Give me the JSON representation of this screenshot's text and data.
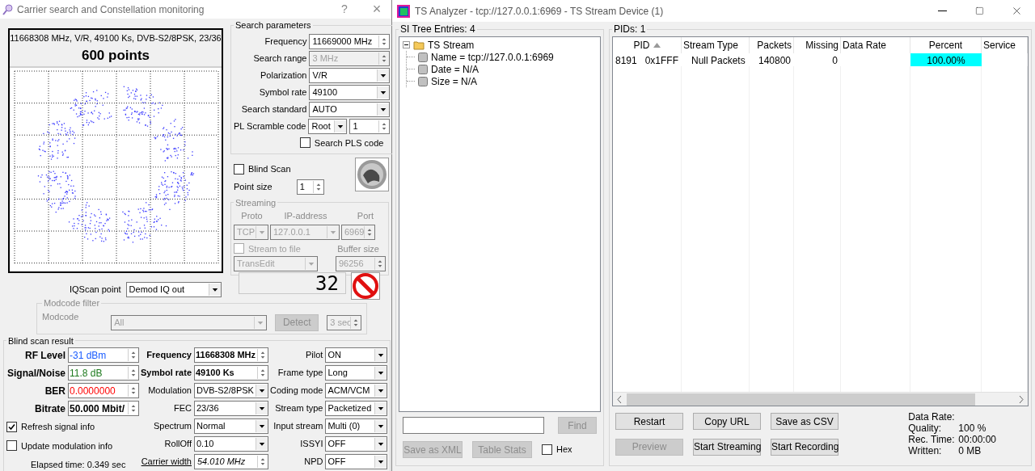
{
  "left_window": {
    "title": "Carrier search and Constellation monitoring",
    "help": "?",
    "close": "×"
  },
  "plot": {
    "info": "11668308 MHz, V/R, 49100 Ks, DVB-S2/8PSK, 23/36",
    "points": "600 points"
  },
  "search_parameters": {
    "title": "Search parameters",
    "fields": [
      {
        "label": "Frequency",
        "value": "11669000 MHz",
        "kind": "spin",
        "disabled": false
      },
      {
        "label": "Search range",
        "value": "3 MHz",
        "kind": "spin",
        "disabled": true
      },
      {
        "label": "Polarization",
        "value": "V/R",
        "kind": "select",
        "disabled": false
      },
      {
        "label": "Symbol rate",
        "value": "49100",
        "kind": "select",
        "disabled": false
      },
      {
        "label": "Search standard",
        "value": "AUTO",
        "kind": "select",
        "disabled": false
      }
    ],
    "scramble": {
      "label": "PL Scramble code",
      "mode": "Root",
      "code": "1"
    },
    "search_pls": {
      "label": "Search PLS code",
      "checked": false
    }
  },
  "blind_scan": {
    "label": "Blind Scan",
    "checked": false
  },
  "point_size": {
    "label": "Point size",
    "value": "1"
  },
  "streaming": {
    "title": "Streaming",
    "disabled": true,
    "proto_label": "Proto",
    "ip_label": "IP-address",
    "port_label": "Port",
    "proto": "TCP",
    "ip": "127.0.0.1",
    "port": "6969",
    "to_file": {
      "label": "Stream to file",
      "checked": false
    },
    "buffer_label": "Buffer size",
    "target": "TransEdit",
    "buffer": "96256"
  },
  "counter": "32",
  "iq_scan": {
    "label": "IQScan point",
    "value": "Demod IQ out"
  },
  "modcode_filter": {
    "title": "Modcode filter",
    "disabled": true,
    "label": "Modcode",
    "value": "All",
    "detect": "Detect",
    "time": "3 sec"
  },
  "blind_scan_result": {
    "title": "Blind scan result",
    "signal": [
      {
        "label": "RF Level",
        "value": "-31 dBm",
        "color": "#1a5cff",
        "bold": false
      },
      {
        "label": "Signal/Noise",
        "value": "11.8 dB",
        "color": "#1e7a1e",
        "bold": false
      },
      {
        "label": "BER",
        "value": "0.0000000",
        "color": "#ff0000",
        "bold": false
      },
      {
        "label": "Bitrate",
        "value": "50.000 Mbit/",
        "color": "#000000",
        "bold": true
      }
    ],
    "params": [
      {
        "label": "Frequency",
        "value": "11668308 MHz",
        "kind": "spin"
      },
      {
        "label": "Symbol rate",
        "value": "49100 Ks",
        "kind": "spin"
      },
      {
        "label": "Modulation",
        "value": "DVB-S2/8PSK",
        "kind": "select"
      },
      {
        "label": "FEC",
        "value": "23/36",
        "kind": "select"
      },
      {
        "label": "Spectrum",
        "value": "Normal",
        "kind": "select"
      },
      {
        "label": "RollOff",
        "value": "0.10",
        "kind": "select"
      },
      {
        "label": "Carrier width",
        "value": "54.010 MHz",
        "kind": "link"
      }
    ],
    "stream": [
      {
        "label": "Pilot",
        "value": "ON"
      },
      {
        "label": "Frame type",
        "value": "Long"
      },
      {
        "label": "Coding mode",
        "value": "ACM/VCM"
      },
      {
        "label": "Stream type",
        "value": "Packetized"
      },
      {
        "label": "Input stream",
        "value": "Multi (0)"
      },
      {
        "label": "ISSYI",
        "value": "OFF"
      },
      {
        "label": "NPD",
        "value": "OFF"
      }
    ],
    "refresh": {
      "label": "Refresh signal info",
      "checked": true
    },
    "update": {
      "label": "Update modulation info",
      "checked": false
    },
    "elapsed": "Elapsed time: 0.349 sec"
  },
  "right_window": {
    "title": "TS Analyzer - tcp://127.0.0.1:6969 - TS Stream Device (1)"
  },
  "si_tree": {
    "title": "SI Tree Entries: 4",
    "items": [
      {
        "label": "TS Stream",
        "expanded": true,
        "children": [
          {
            "label": "Name = tcp://127.0.0.1:6969"
          },
          {
            "label": "Date = N/A"
          },
          {
            "label": "Size = N/A"
          }
        ]
      }
    ],
    "find": {
      "label": "Find",
      "disabled": true
    },
    "actions": [
      {
        "label": "Save as XML",
        "disabled": true
      },
      {
        "label": "Table Stats",
        "disabled": true
      }
    ],
    "hex": {
      "label": "Hex",
      "checked": false
    }
  },
  "pids": {
    "title": "PIDs: 1",
    "columns": [
      {
        "label": "PID",
        "sorted": true
      },
      {
        "label": "Stream Type",
        "sorted": false
      },
      {
        "label": "Packets",
        "sorted": false
      },
      {
        "label": "Missing",
        "sorted": false
      },
      {
        "label": "Data Rate",
        "sorted": false
      },
      {
        "label": "Percent",
        "sorted": false
      },
      {
        "label": "Service",
        "sorted": false
      }
    ],
    "rows": [
      {
        "pid": "8191",
        "hex": "0x1FFF",
        "stream_type": "Null Packets",
        "packets": "140800",
        "missing": "0",
        "percent": "100.00%",
        "level": 1
      }
    ],
    "buttons": [
      {
        "label": "Restart",
        "disabled": false
      },
      {
        "label": "Copy URL",
        "disabled": false
      },
      {
        "label": "Save as CSV",
        "disabled": false
      },
      {
        "label": "Preview",
        "disabled": true
      },
      {
        "label": "Start Streaming",
        "disabled": false
      },
      {
        "label": "Start Recording",
        "disabled": false
      }
    ],
    "stats": [
      {
        "label": "Data Rate:"
      },
      {
        "label": "Quality:",
        "value": "100 %"
      },
      {
        "label": "Rec. Time:",
        "value": "00:00:00"
      },
      {
        "label": "Written:",
        "value": "0 MB"
      }
    ]
  }
}
